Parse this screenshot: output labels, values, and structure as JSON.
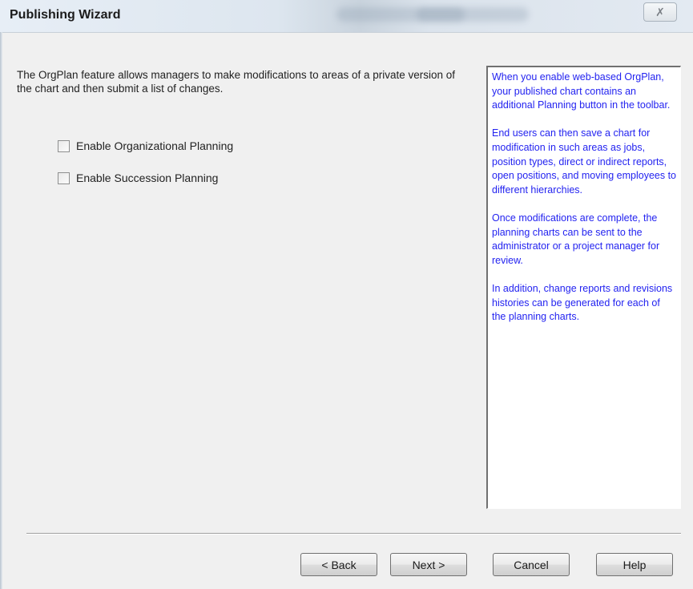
{
  "window": {
    "title": "Publishing Wizard",
    "close_glyph": "✗"
  },
  "main": {
    "intro": "The OrgPlan feature allows managers to make modifications to areas of a private version of the chart and then submit a list of changes.",
    "options": [
      {
        "label": "Enable Organizational Planning",
        "checked": false
      },
      {
        "label": "Enable Succession Planning",
        "checked": false
      }
    ]
  },
  "help": {
    "color": "#2323f0",
    "paragraphs": [
      "When you enable web-based OrgPlan, your published chart contains an additional Planning button in the toolbar.",
      "End users can then save a chart for modification in such areas as jobs, position types, direct or indirect reports, open positions, and moving employees to different hierarchies.",
      "Once modifications are complete, the planning charts can be sent to the administrator or a project manager for review.",
      "In addition, change reports and revisions histories can be generated for each of the planning charts."
    ]
  },
  "buttons": {
    "back": "< Back",
    "next": "Next >",
    "cancel": "Cancel",
    "help": "Help"
  }
}
